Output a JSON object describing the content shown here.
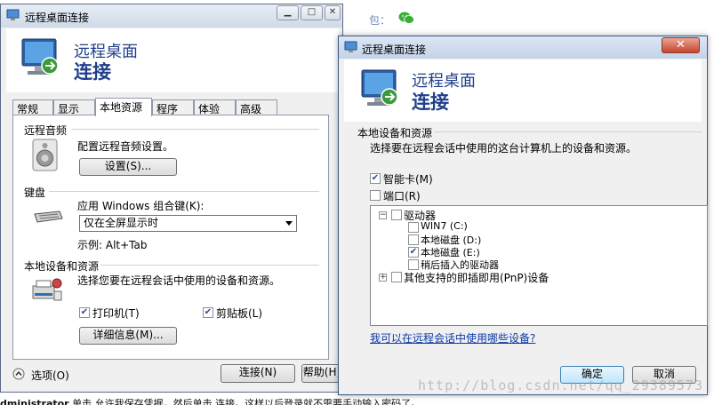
{
  "background": {
    "top_text": "包：",
    "bottom_bold": "dministrator",
    "bottom_text": "  单击 允许我保存凭据，然后单击 连接。这样以后登录就不需要手动输入密码了。",
    "watermark": "http://blog.csdn.net/qq_29389573"
  },
  "window1": {
    "title": "远程桌面连接",
    "header_line1": "远程桌面",
    "header_line2": "连接",
    "tabs": [
      {
        "label": "常规",
        "active": false
      },
      {
        "label": "显示",
        "active": false
      },
      {
        "label": "本地资源",
        "active": true
      },
      {
        "label": "程序",
        "active": false
      },
      {
        "label": "体验",
        "active": false
      },
      {
        "label": "高级",
        "active": false
      }
    ],
    "audio": {
      "group": "远程音频",
      "description": "配置远程音频设置。",
      "button": "设置(S)..."
    },
    "keyboard": {
      "group": "键盘",
      "label": "应用 Windows 组合键(K):",
      "selected": "仅在全屏显示时",
      "example": "示例: Alt+Tab"
    },
    "devices": {
      "group": "本地设备和资源",
      "description": "选择您要在远程会话中使用的设备和资源。",
      "printer": "打印机(T)",
      "printer_checked": true,
      "clipboard": "剪贴板(L)",
      "clipboard_checked": true,
      "details_button": "详细信息(M)..."
    },
    "options": "选项(O)",
    "connect": "连接(N)",
    "help": "帮助(H)"
  },
  "window2": {
    "title": "远程桌面连接",
    "header_line1": "远程桌面",
    "header_line2": "连接",
    "group": "本地设备和资源",
    "description": "选择要在远程会话中使用的这台计算机上的设备和资源。",
    "smartcard": "智能卡(M)",
    "smartcard_checked": true,
    "ports": "端口(R)",
    "ports_checked": false,
    "tree": {
      "drives": "驱动器",
      "drive_items": [
        {
          "label": "WIN7 (C:)",
          "checked": false
        },
        {
          "label": "本地磁盘 (D:)",
          "checked": false
        },
        {
          "label": "本地磁盘 (E:)",
          "checked": true
        },
        {
          "label": "稍后插入的驱动器",
          "checked": false
        }
      ],
      "pnp": "其他支持的即插即用(PnP)设备"
    },
    "link": "我可以在远程会话中使用哪些设备?",
    "ok": "确定",
    "cancel": "取消"
  },
  "colors": {
    "header_text": "#1f3f8a",
    "link": "#0b3aa8",
    "close_button": "#c7452c"
  }
}
